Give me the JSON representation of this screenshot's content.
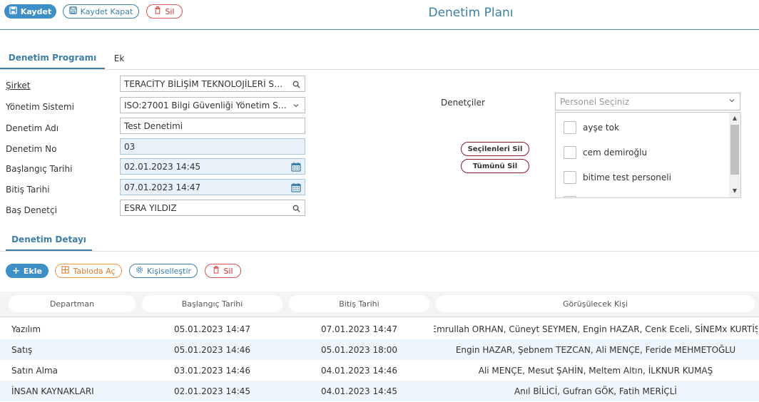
{
  "toolbar": {
    "save_label": "Kaydet",
    "save_close_label": "Kaydet Kapat",
    "delete_label": "Sil"
  },
  "page_title": "Denetim Planı",
  "top_tabs": [
    {
      "label": "Denetim Programı",
      "active": true
    },
    {
      "label": "Ek",
      "active": false
    }
  ],
  "form": {
    "company": {
      "label": "Şirket",
      "value": "TERACİTY BİLİŞİM TEKNOLOJİLERİ SAN. TİC."
    },
    "management_system": {
      "label": "Yönetim Sistemi",
      "value": "ISO:27001 Bilgi Güvenliği Yönetim Sistemi"
    },
    "audit_name": {
      "label": "Denetim Adı",
      "value": "Test Denetimi"
    },
    "audit_no": {
      "label": "Denetim No",
      "value": "03"
    },
    "start_date": {
      "label": "Başlangıç Tarihi",
      "value": "02.01.2023 14:45"
    },
    "end_date": {
      "label": "Bitiş Tarihi",
      "value": "07.01.2023 14:47"
    },
    "lead_auditor": {
      "label": "Baş Denetçi",
      "value": "ESRA YILDIZ"
    }
  },
  "auditors": {
    "label": "Denetçiler",
    "placeholder": "Personel Seçiniz",
    "remove_selected_label": "Seçilenleri Sil",
    "remove_all_label": "Tümünü Sil",
    "options": [
      {
        "label": "ayşe tok",
        "checked": false
      },
      {
        "label": "cem demiroğlu",
        "checked": false
      },
      {
        "label": "bitime test personeli",
        "checked": false
      }
    ]
  },
  "detail_tab": {
    "label": "Denetim Detayı"
  },
  "detail_toolbar": {
    "add_label": "Ekle",
    "open_table_label": "Tabloda Aç",
    "customize_label": "Kişiselleştir",
    "delete_label": "Sil"
  },
  "table": {
    "columns": [
      "Departman",
      "Başlangıç Tarihi",
      "Bitiş Tarihi",
      "Görüşülecek Kişi"
    ],
    "rows": [
      [
        "Yazılım",
        "05.01.2023 14:47",
        "07.01.2023 14:47",
        "Emrullah ORHAN, Cüneyt SEYMEN, Engin HAZAR, Cenk Eceli, SİNEMx KURTİŞ"
      ],
      [
        "Satış",
        "05.01.2023 14:46",
        "05.01.2023 18:00",
        "Engin HAZAR, Şebnem TEZCAN, Ali MENÇE, Feride MEHMETOĞLU"
      ],
      [
        "Satın Alma",
        "03.01.2023 14:46",
        "04.01.2023 14:46",
        "Ali MENÇE, Mesut ŞAHİN, Meltem Altın, İLKNUR KUMAŞ"
      ],
      [
        "İNSAN KAYNAKLARI",
        "02.01.2023 14:45",
        "04.01.2023 14:45",
        "Anıl BİLİCİ, Gufran GÖK, Fatih MERİÇLİ"
      ]
    ]
  },
  "colors": {
    "accent": "#3d8fc6",
    "danger": "#d9534f",
    "warning": "#e8924a"
  }
}
